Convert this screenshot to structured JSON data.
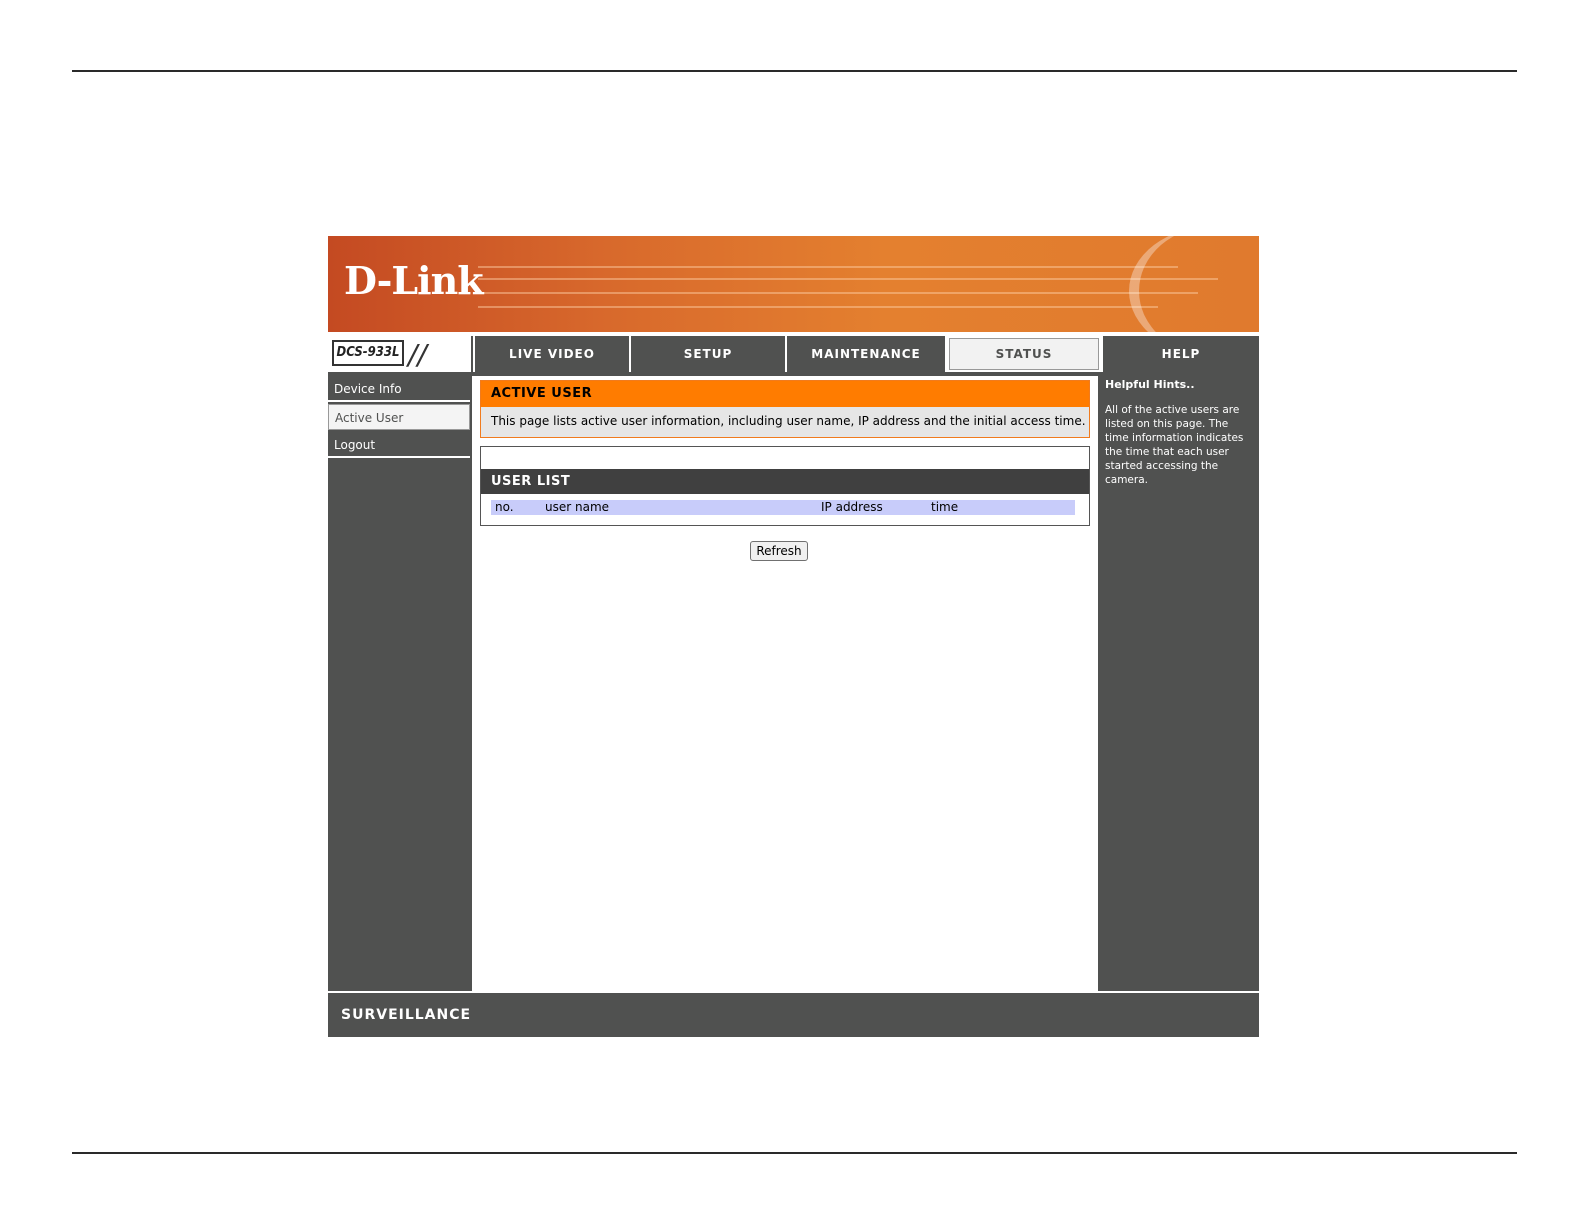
{
  "brand": {
    "logo": "D-Link",
    "model": "DCS-933L",
    "footer": "SURVEILLANCE"
  },
  "nav": {
    "tabs": [
      {
        "label": "LIVE VIDEO",
        "active": false
      },
      {
        "label": "SETUP",
        "active": false
      },
      {
        "label": "MAINTENANCE",
        "active": false
      },
      {
        "label": "STATUS",
        "active": true
      },
      {
        "label": "HELP",
        "active": false
      }
    ]
  },
  "sidebar": {
    "items": [
      {
        "label": "Device Info",
        "active": false
      },
      {
        "label": "Active User",
        "active": true
      },
      {
        "label": "Logout",
        "active": false
      }
    ]
  },
  "main": {
    "section_title": "ACTIVE USER",
    "description": "This page lists active user information, including user name, IP address and the initial access time.",
    "user_list": {
      "title": "USER LIST",
      "columns": [
        "no.",
        "user name",
        "IP address",
        "time"
      ],
      "rows": []
    },
    "refresh_label": "Refresh"
  },
  "help": {
    "title": "Helpful Hints..",
    "text": "All of the active users are listed on this page. The time information indicates the time that each user started accessing the camera."
  },
  "colors": {
    "accent": "#ff7c00",
    "frame": "#505150",
    "table_header": "#c8ccfa"
  }
}
